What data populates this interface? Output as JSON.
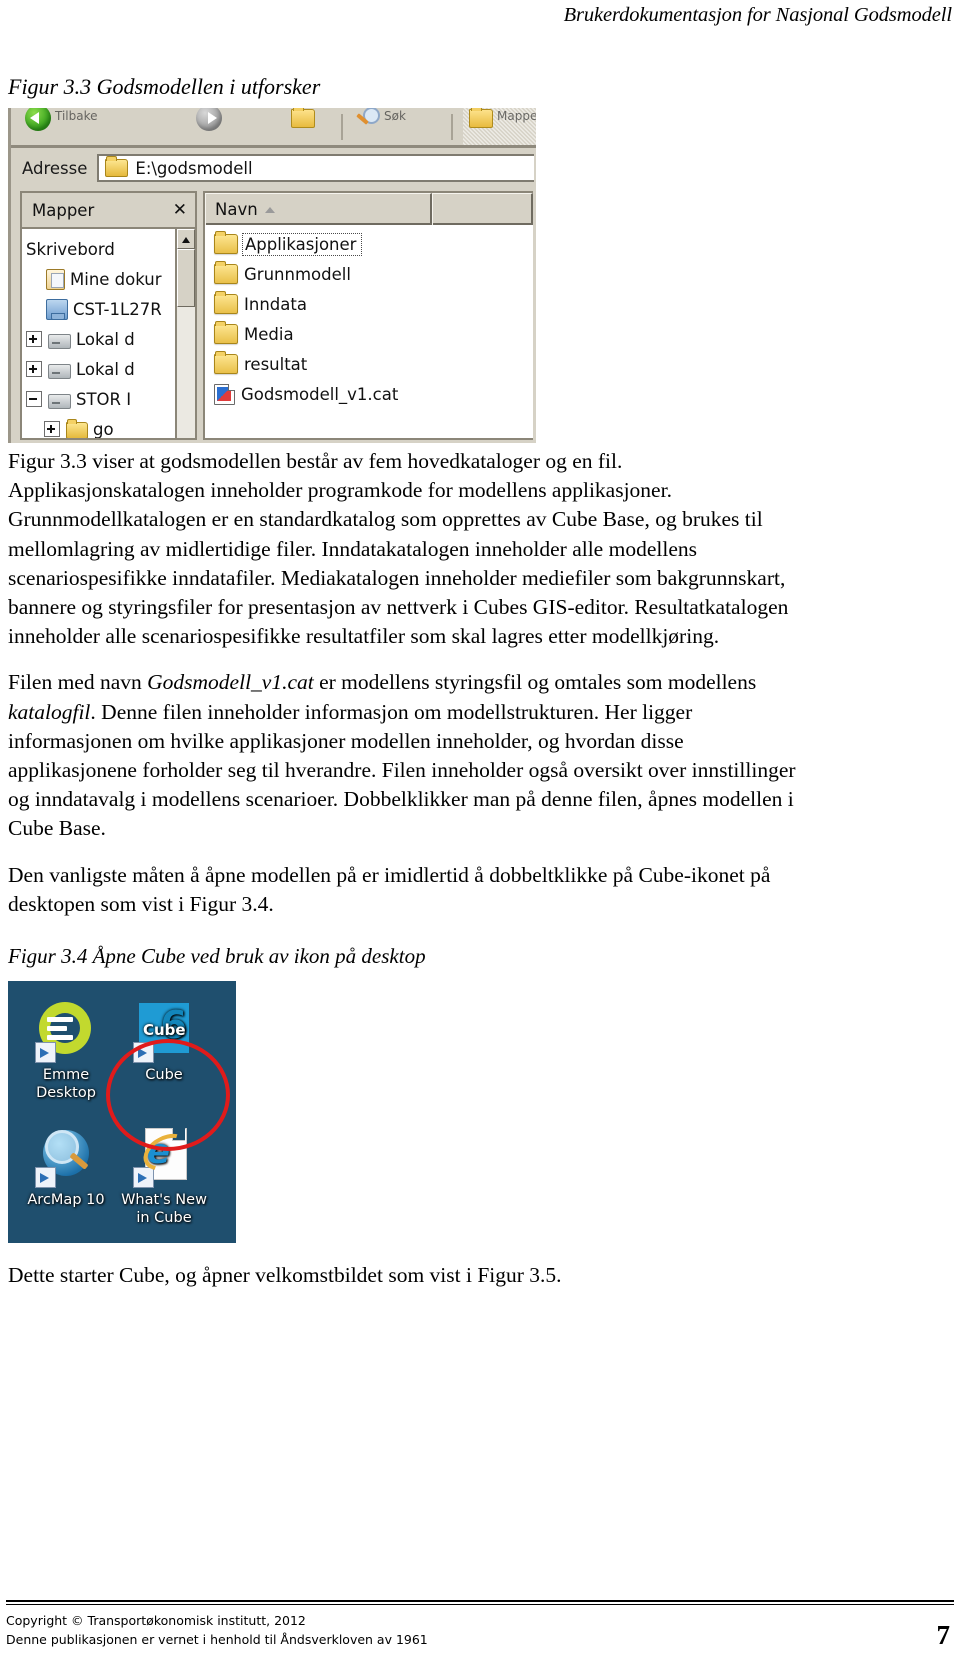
{
  "header": {
    "running_title": "Brukerdokumentasjon for Nasjonal Godsmodell"
  },
  "figure_3_3": {
    "caption": "Figur 3.3 Godsmodellen i utforsker",
    "explorer": {
      "toolbar": {
        "back_label": "Tilbake",
        "forward_label": "",
        "up_label": "",
        "search_label": "Søk",
        "folders_label": "Mapper"
      },
      "address": {
        "label": "Adresse",
        "value": "E:\\godsmodell"
      },
      "folders_pane": {
        "title": "Mapper",
        "close_label": "✕",
        "tree_items": [
          {
            "label": "Skrivebord",
            "icon": "desktop-icon",
            "expander": "none",
            "indent": 0
          },
          {
            "label": "Mine dokur",
            "icon": "documents-icon",
            "expander": "none",
            "indent": 1
          },
          {
            "label": "CST-1L27R",
            "icon": "computer-icon",
            "expander": "none",
            "indent": 1
          },
          {
            "label": "Lokal d",
            "icon": "drive-icon",
            "expander": "plus",
            "indent": 1
          },
          {
            "label": "Lokal d",
            "icon": "drive-icon",
            "expander": "plus",
            "indent": 1
          },
          {
            "label": "STOR I",
            "icon": "drive-icon",
            "expander": "minus",
            "indent": 1
          },
          {
            "label": "go",
            "icon": "folder-open-icon",
            "expander": "plus",
            "indent": 2
          }
        ]
      },
      "list_pane": {
        "columns": [
          "Navn",
          ""
        ],
        "sort_column": "Navn",
        "rows": [
          {
            "name": "Applikasjoner",
            "icon": "folder-icon",
            "selected": true
          },
          {
            "name": "Grunnmodell",
            "icon": "folder-icon",
            "selected": false
          },
          {
            "name": "Inndata",
            "icon": "folder-icon",
            "selected": false
          },
          {
            "name": "Media",
            "icon": "folder-icon",
            "selected": false
          },
          {
            "name": "resultat",
            "icon": "folder-icon",
            "selected": false
          },
          {
            "name": "Godsmodell_v1.cat",
            "icon": "cat-file-icon",
            "selected": false
          }
        ]
      }
    }
  },
  "body": {
    "p1_part1": "Figur 3.3 viser at godsmodellen består av fem hovedkataloger og en fil. Applikasjonskatalogen inneholder programkode for modellens applikasjoner. Grunnmodellkatalogen er en standardkatalog som opprettes av Cube Base, og brukes til mellomlagring av midlertidige filer. Inndatakatalogen inneholder alle modellens scenariospesifikke inndatafiler. Mediakatalogen inneholder mediefiler som bakgrunnskart, bannere og styringsfiler for presentasjon av nettverk i Cubes GIS-editor. Resultatkatalogen inneholder alle scenariospesifikke resultatfiler som skal lagres etter modellkjøring.",
    "p2_a": "Filen med navn ",
    "p2_em1": "Godsmodell_v1.cat",
    "p2_b": " er modellens styringsfil og omtales som modellens ",
    "p2_em2": "katalogfil",
    "p2_c": ".  Denne filen inneholder informasjon om modellstrukturen. Her ligger informasjonen om hvilke applikasjoner modellen inneholder, og hvordan disse applikasjonene forholder seg til hverandre. Filen inneholder også oversikt over innstillinger og inndatavalg i modellens scenarioer. Dobbelklikker man på denne filen, åpnes modellen i Cube Base.",
    "p3": "Den vanligste måten å åpne modellen på er imidlertid å dobbeltklikke på Cube-ikonet på desktopen som vist i Figur 3.4.",
    "p4": "Dette starter Cube, og åpner velkomstbildet som vist i Figur 3.5."
  },
  "figure_3_4": {
    "caption": "Figur 3.4 Åpne Cube ved bruk av ikon på desktop",
    "desktop": {
      "background_color": "#1f4f6e",
      "highlight_color": "#e01b1b",
      "icons": [
        {
          "label_line1": "Emme",
          "label_line2": "Desktop",
          "icon": "emme-desktop-icon",
          "highlighted": false
        },
        {
          "label_line1": "Cube",
          "label_line2": "",
          "icon": "cube-icon",
          "highlighted": true,
          "tile_text": "Cube",
          "tile_version": "6"
        },
        {
          "label_line1": "ArcMap 10",
          "label_line2": "",
          "icon": "arcmap-icon",
          "highlighted": false
        },
        {
          "label_line1": "What's New",
          "label_line2": "in Cube",
          "icon": "whats-new-in-cube-icon",
          "highlighted": false
        }
      ]
    }
  },
  "footer": {
    "line1": "Copyright © Transportøkonomisk institutt, 2012",
    "line2": "Denne publikasjonen er vernet i henhold til Åndsverkloven av 1961",
    "page_number": "7"
  }
}
